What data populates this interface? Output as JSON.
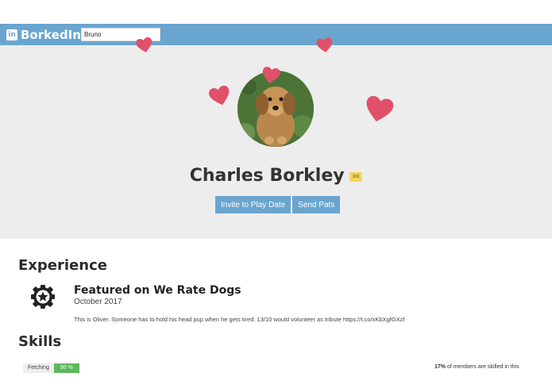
{
  "navbar": {
    "brand_icon_text": "in",
    "brand_name": "BorkedIn",
    "search_value": "Bruno"
  },
  "profile": {
    "name": "Charles Borkley",
    "connection_degree": "3rd",
    "invite_button": "Invite to Play Date",
    "pats_button": "Send Pats"
  },
  "experience": {
    "heading": "Experience",
    "items": [
      {
        "icon": "badge-star-icon",
        "title": "Featured on We Rate Dogs",
        "date": "October 2017",
        "description": "This is Oliver. Someone has to hold his head pup when he gets tired. 13/10 would volunteer as tribute https://t.co/xKbXgfGXzf"
      }
    ]
  },
  "skills": {
    "heading": "Skills",
    "items": [
      {
        "name": "Fetching",
        "level": "90 %",
        "stat_percent": "17%",
        "stat_text": " of members are skilled in this"
      }
    ]
  },
  "colors": {
    "navbar": "#6aa5cf",
    "hero_background": "#ededed",
    "heart": "#e0506b",
    "badge": "#f4d75a",
    "skill_level": "#5cb85c"
  }
}
